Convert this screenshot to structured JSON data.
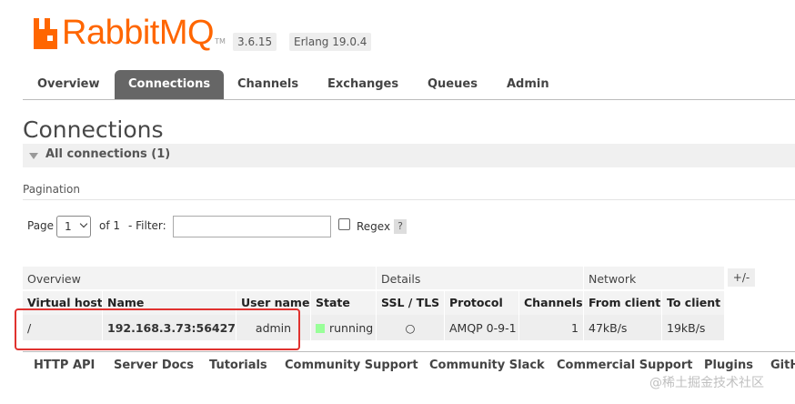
{
  "header": {
    "logo_text": "RabbitMQ",
    "logo_tm": "TM",
    "version": "3.6.15",
    "erlang": "Erlang 19.0.4"
  },
  "tabs": [
    {
      "label": "Overview",
      "active": false
    },
    {
      "label": "Connections",
      "active": true
    },
    {
      "label": "Channels",
      "active": false
    },
    {
      "label": "Exchanges",
      "active": false
    },
    {
      "label": "Queues",
      "active": false
    },
    {
      "label": "Admin",
      "active": false
    }
  ],
  "page_title": "Connections",
  "section": {
    "label": "All connections (1)"
  },
  "pagination": {
    "label": "Pagination",
    "page_label": "Page",
    "page_value": "1",
    "of_label": "of 1",
    "filter_label": "- Filter:",
    "filter_value": "",
    "regex_label": "Regex",
    "help": "?"
  },
  "table": {
    "groups": [
      "Overview",
      "Details",
      "Network"
    ],
    "plus_minus": "+/-",
    "headers": [
      "Virtual host",
      "Name",
      "User name",
      "State",
      "SSL / TLS",
      "Protocol",
      "Channels",
      "From client",
      "To client"
    ],
    "row": {
      "vhost": "/",
      "name": "192.168.3.73:56427",
      "user": "admin",
      "state": "running",
      "ssl": "○",
      "protocol": "AMQP 0-9-1",
      "channels": "1",
      "from_client": "47kB/s",
      "to_client": "19kB/s"
    }
  },
  "footer": [
    "HTTP API",
    "Server Docs",
    "Tutorials",
    "Community Support",
    "Community Slack",
    "Commercial Support",
    "Plugins",
    "GitH"
  ],
  "watermark": "@稀土掘金技术社区",
  "colors": {
    "brand": "#ff6600",
    "active_tab": "#666666",
    "running": "#99ff99",
    "highlight": "#e0322f"
  }
}
